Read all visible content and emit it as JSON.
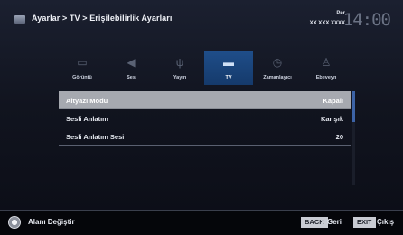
{
  "header": {
    "breadcrumb": "Ayarlar > TV > Erişilebilirlik Ayarları",
    "day": "Per",
    "date": "XX XXX XXXX",
    "time": "14:00"
  },
  "tabs": [
    {
      "label": "Görüntü",
      "icon": "picture-icon",
      "glyph": "▭"
    },
    {
      "label": "Ses",
      "icon": "speaker-icon",
      "glyph": "◀"
    },
    {
      "label": "Yayın",
      "icon": "antenna-icon",
      "glyph": "ψ"
    },
    {
      "label": "TV",
      "icon": "tv-icon",
      "glyph": "▬"
    },
    {
      "label": "Zamanlayıcı",
      "icon": "timer-icon",
      "glyph": "◷"
    },
    {
      "label": "Ebeveyn",
      "icon": "parental-lock-icon",
      "glyph": "♙"
    }
  ],
  "active_tab": "TV",
  "settings": [
    {
      "label": "Altyazı Modu",
      "value": "Kapalı"
    },
    {
      "label": "Sesli Anlatım",
      "value": "Karışık"
    },
    {
      "label": "Sesli Anlatım Sesi",
      "value": "20"
    }
  ],
  "footer": {
    "nav_hint": "Alanı Değiştir",
    "back_key": "BACK",
    "back_label": "Geri",
    "exit_key": "EXIT",
    "exit_label": "Çıkış"
  },
  "colors": {
    "accent": "#1f4e8a",
    "selected_row": "#a6a9b0",
    "scrollbar": "#3c63a6"
  }
}
